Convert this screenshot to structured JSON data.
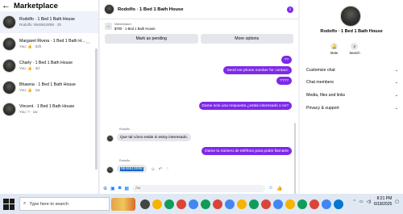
{
  "sidebar": {
    "title": "Marketplace",
    "conversations": [
      {
        "name": "Rodolfo · 1 Bed 1 Bath House",
        "sub": "Rodolfo: 9546610068 · 2h",
        "active": true
      },
      {
        "name": "Margaret Rivera · 1 Bed 1 Bath H...",
        "sub_prefix": "You: ",
        "sub": "· 22h"
      },
      {
        "name": "Charly · 1 Bed 1 Bath House",
        "sub_prefix": "You: ",
        "sub": "· 4d"
      },
      {
        "name": "Bhawna · 1 Bed 1 Bath House",
        "sub_prefix": "You: ",
        "sub": "· 1w"
      },
      {
        "name": "Vincent · 1 Bed 1 Bath House",
        "sub": "You: ? · 1w"
      }
    ]
  },
  "chat": {
    "title": "Rodolfo · 1 Bed 1 Bath House",
    "listing_label": "Marketplace",
    "listing_price": "$700 · 1 Bed 1 Bath House",
    "mark_pending_label": "Mark as pending",
    "more_options_label": "More options",
    "messages_out": [
      {
        "text": "??"
      },
      {
        "text": "Send me phone number for contact."
      },
      {
        "text": "????"
      },
      {
        "text": "Dame solo una respuesta ¿estás interesado o no?"
      },
      {
        "text": "Dame tu número de teléfono para poder llamarte"
      }
    ],
    "sender_name": "Rodolfo",
    "messages_in": [
      {
        "text": "Que tal cómo estás si estoy interesado."
      },
      {
        "text": "9546610068"
      }
    ],
    "composer_placeholder": "Aa"
  },
  "info_panel": {
    "name": "Rodolfo · 1 Bed 1 Bath House",
    "mute_label": "Mute",
    "search_label": "Search",
    "sections": [
      "Customize chat",
      "Chat members",
      "Media, files and links",
      "Privacy & support"
    ]
  },
  "taskbar": {
    "search_placeholder": "Type here to search",
    "time": "8:21 PM",
    "date": "6/18/2025"
  }
}
